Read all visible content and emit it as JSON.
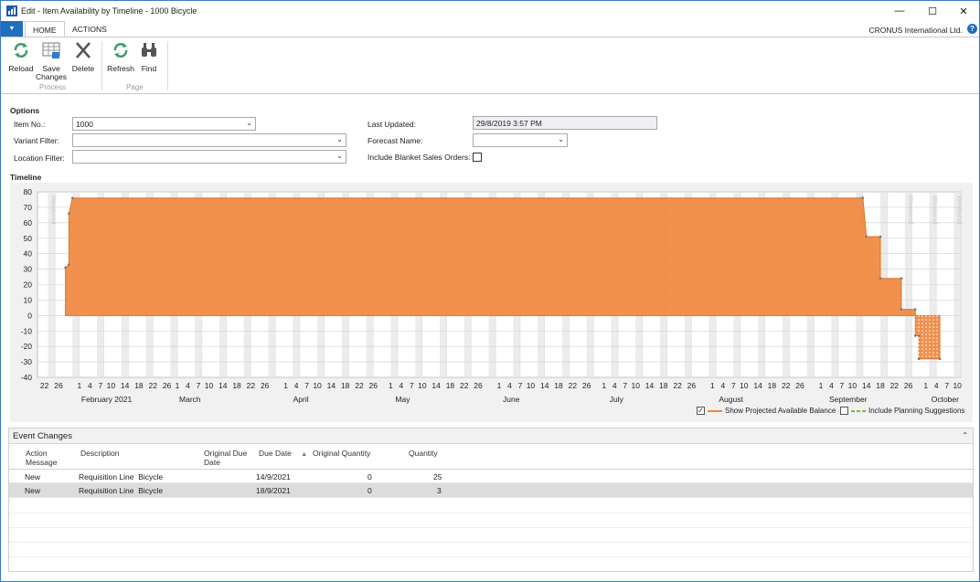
{
  "window": {
    "title": "Edit - Item Availability by Timeline - 1000 Bicycle"
  },
  "ribbon": {
    "tabs": {
      "home": "HOME",
      "actions": "ACTIONS"
    },
    "company": "CRONUS International Ltd.",
    "buttons": {
      "reload": "Reload",
      "save_changes_line1": "Save",
      "save_changes_line2": "Changes",
      "delete": "Delete",
      "refresh": "Refresh",
      "find": "Find"
    },
    "groups": {
      "process": "Process",
      "page": "Page"
    }
  },
  "options": {
    "title": "Options",
    "item_no": {
      "label": "Item No.:",
      "value": "1000"
    },
    "variant_filter": {
      "label": "Variant Filter:",
      "value": ""
    },
    "location_filter": {
      "label": "Location Filter:",
      "value": ""
    },
    "last_updated": {
      "label": "Last Updated:",
      "value": "29/8/2019 3:57 PM"
    },
    "forecast_name": {
      "label": "Forecast Name:",
      "value": ""
    },
    "include_blanket": {
      "label": "Include Blanket Sales Orders:",
      "checked": false
    }
  },
  "timeline": {
    "title": "Timeline",
    "legend": {
      "projected": {
        "label": "Show Projected Available Balance",
        "checked": true
      },
      "planning": {
        "label": "Include Planning Suggestions",
        "checked": false
      }
    }
  },
  "chart_data": {
    "type": "area",
    "series": [
      {
        "name": "Show Projected Available Balance",
        "color": "#f0883e",
        "points": [
          [
            "2021-01-28",
            0
          ],
          [
            "2021-01-28",
            31
          ],
          [
            "2021-01-29",
            33
          ],
          [
            "2021-01-29",
            66
          ],
          [
            "2021-01-30",
            76
          ],
          [
            "2021-09-13",
            76
          ],
          [
            "2021-09-14",
            51
          ],
          [
            "2021-09-18",
            51
          ],
          [
            "2021-09-18",
            24
          ],
          [
            "2021-09-24",
            24
          ],
          [
            "2021-09-24",
            4
          ],
          [
            "2021-09-28",
            4
          ],
          [
            "2021-09-28",
            -13
          ],
          [
            "2021-09-29",
            -13
          ],
          [
            "2021-09-29",
            -28
          ],
          [
            "2021-10-05",
            -28
          ],
          [
            "2021-10-05",
            0
          ]
        ]
      }
    ],
    "ylim": [
      -40,
      80
    ],
    "yticks": [
      80,
      70,
      60,
      50,
      40,
      30,
      20,
      10,
      0,
      -10,
      -20,
      -30,
      -40
    ],
    "xlim": [
      "2021-01-20",
      "2021-10-11"
    ],
    "xtick_days": [
      "22",
      "26",
      "1",
      "4",
      "7",
      "10",
      "14",
      "18",
      "22",
      "26",
      "1",
      "4",
      "7",
      "10",
      "14",
      "18",
      "22",
      "26",
      "1",
      "4",
      "7",
      "10",
      "14",
      "18",
      "22",
      "26",
      "1",
      "4",
      "7",
      "10",
      "14",
      "18",
      "22",
      "26",
      "1",
      "4",
      "7",
      "10",
      "14",
      "18",
      "22",
      "26",
      "1",
      "4",
      "7",
      "10",
      "14",
      "18",
      "22",
      "26",
      "1",
      "4",
      "7",
      "10",
      "14",
      "18",
      "22",
      "26",
      "1",
      "4",
      "7",
      "10",
      "14",
      "18",
      "22",
      "26",
      "1",
      "4",
      "7",
      "10",
      "14",
      "18",
      "22",
      "26",
      "1",
      "4",
      "7",
      "10"
    ],
    "months": [
      "February 2021",
      "March",
      "April",
      "May",
      "June",
      "July",
      "August",
      "September",
      "October"
    ],
    "weekend_label": "Weekend",
    "grid": true
  },
  "events": {
    "title": "Event Changes",
    "columns": {
      "action_message": [
        "Action",
        "Message"
      ],
      "description": "Description",
      "original_due_date": [
        "Original Due",
        "Date"
      ],
      "due_date": "Due Date",
      "original_quantity": "Original Quantity",
      "quantity": "Quantity"
    },
    "rows": [
      {
        "action": "New",
        "description": "Requisition Line  Bicycle",
        "original_due_date": "",
        "due_date": "14/9/2021",
        "original_quantity": "0",
        "quantity": "25"
      },
      {
        "action": "New",
        "description": "Requisition Line  Bicycle",
        "original_due_date": "",
        "due_date": "18/9/2021",
        "original_quantity": "0",
        "quantity": "3"
      }
    ]
  }
}
